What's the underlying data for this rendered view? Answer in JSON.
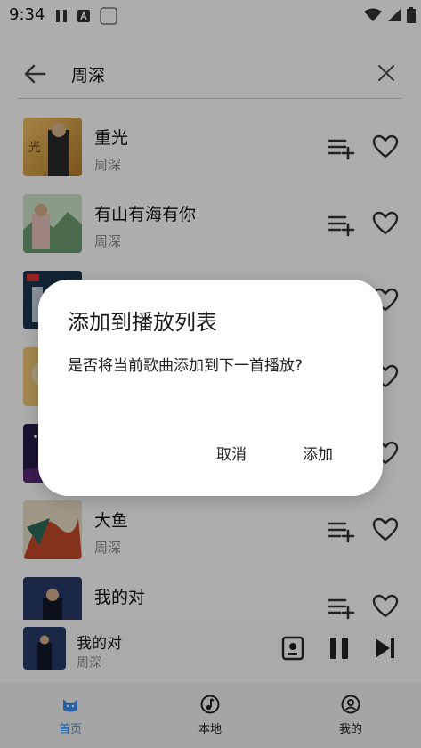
{
  "status_bar": {
    "time": "9:34"
  },
  "search": {
    "query": "周深"
  },
  "songs": [
    {
      "title": "重光",
      "artist": "周深"
    },
    {
      "title": "有山有海有你",
      "artist": "周深"
    },
    {
      "title": "",
      "artist": ""
    },
    {
      "title": "",
      "artist": ""
    },
    {
      "title": "",
      "artist": ""
    },
    {
      "title": "大鱼",
      "artist": "周深"
    },
    {
      "title": "我的对",
      "artist": ""
    }
  ],
  "dialog": {
    "title": "添加到播放列表",
    "message": "是否将当前歌曲添加到下一首播放?",
    "cancel_label": "取消",
    "confirm_label": "添加"
  },
  "mini_player": {
    "title": "我的对",
    "artist": "周深"
  },
  "bottom_nav": {
    "items": [
      {
        "label": "首页",
        "icon": "cat-icon",
        "active": true
      },
      {
        "label": "本地",
        "icon": "music-note-icon",
        "active": false
      },
      {
        "label": "我的",
        "icon": "user-circle-icon",
        "active": false
      }
    ]
  },
  "colors": {
    "accent": "#3d8ff0",
    "scrim": "rgba(0,0,0,0.32)"
  }
}
